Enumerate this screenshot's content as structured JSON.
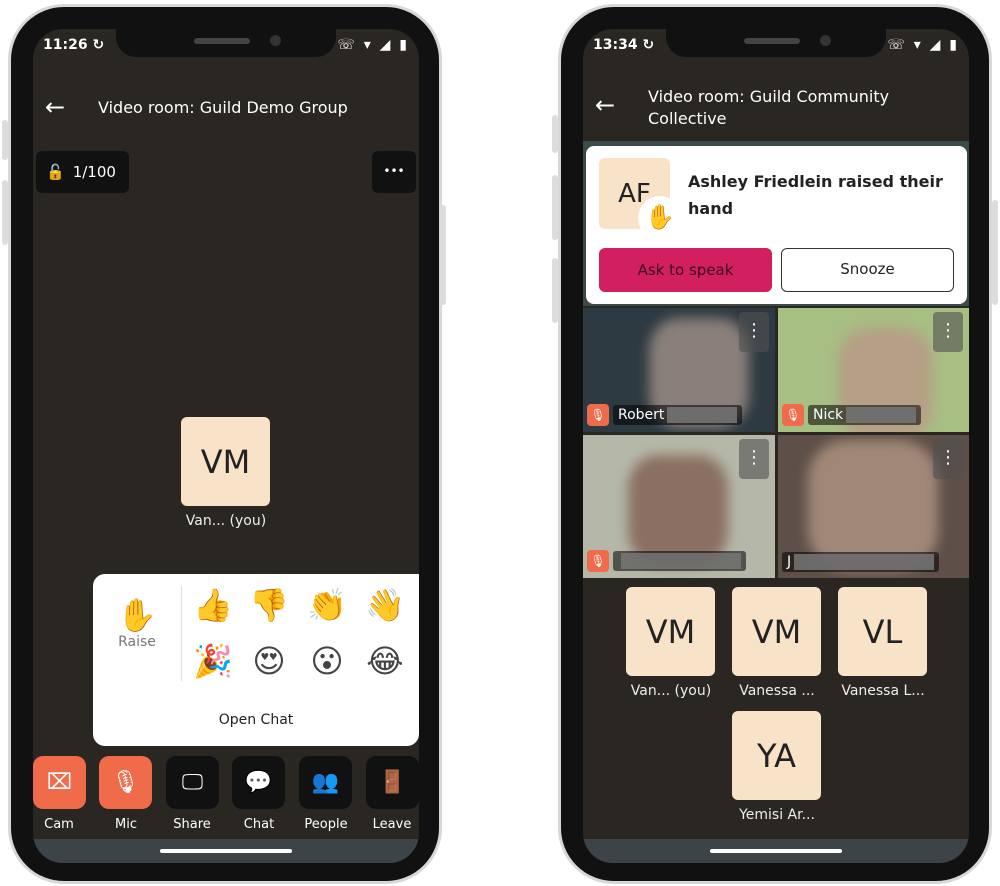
{
  "left": {
    "status": {
      "time": "11:26",
      "icons": "↻",
      "system": "☏ ▾ ◢ ▮"
    },
    "header": {
      "back_icon": "←",
      "title": "Video room: Guild Demo Group"
    },
    "room_badge": {
      "lock_icon": "🔓",
      "count": "1/100"
    },
    "more_icon": "•••",
    "self_tile": {
      "initials": "VM",
      "label": "Van...  (you)"
    },
    "reactions": {
      "raise_icon": "✋",
      "raise_label": "Raise",
      "emojis": [
        "👍",
        "👎",
        "👏",
        "👋",
        "🎉",
        "😍",
        "😮",
        "😂"
      ],
      "open_chat": "Open Chat"
    },
    "toolbar": [
      {
        "label": "Cam",
        "icon": "cam-off",
        "glyph": "⌧"
      },
      {
        "label": "Mic",
        "icon": "mic-off",
        "glyph": "🎙"
      },
      {
        "label": "Share",
        "icon": "monitor",
        "glyph": "🖵"
      },
      {
        "label": "Chat",
        "icon": "chat",
        "glyph": "💬"
      },
      {
        "label": "People",
        "icon": "people",
        "glyph": "👥"
      },
      {
        "label": "Leave",
        "icon": "door",
        "glyph": "🚪"
      }
    ]
  },
  "right": {
    "status": {
      "time": "13:34",
      "icons": "↻",
      "system": "☏ ▾ ◢ ▮"
    },
    "header": {
      "back_icon": "←",
      "title_line1": "Video room: Guild Community",
      "title_line2": "Collective"
    },
    "notification": {
      "initials": "AF",
      "hand_icon": "✋",
      "message": "Ashley Friedlein raised their hand",
      "primary": "Ask to speak",
      "secondary": "Snooze",
      "accent": "#d21f5f"
    },
    "videos": [
      {
        "name": "Robert"
      },
      {
        "name": "Nick"
      },
      {
        "name": ""
      },
      {
        "name": "J"
      }
    ],
    "tiles": [
      {
        "initials": "VM",
        "label": "Van...  (you)"
      },
      {
        "initials": "VM",
        "label": "Vanessa ..."
      },
      {
        "initials": "VL",
        "label": "Vanessa L..."
      },
      {
        "initials": "YA",
        "label": "Yemisi Ar..."
      }
    ]
  },
  "colors": {
    "background": "#2a2622",
    "tile": "#f8e3c9",
    "muted": "#ef6b4a"
  }
}
